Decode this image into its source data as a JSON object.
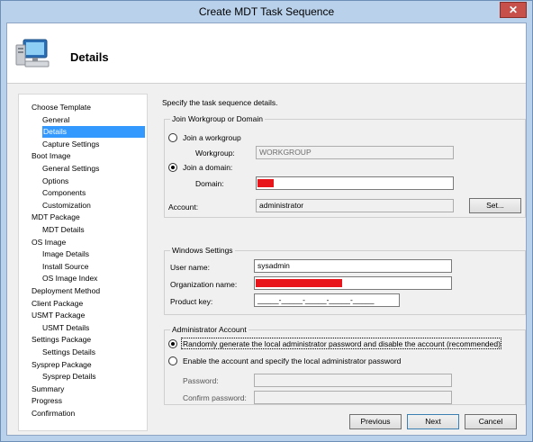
{
  "window": {
    "title": "Create MDT Task Sequence",
    "close_label": "✕"
  },
  "header": {
    "title": "Details",
    "icon": "computer-icon"
  },
  "sidebar": {
    "items": [
      {
        "label": "Choose Template",
        "level": 0,
        "selected": false
      },
      {
        "label": "General",
        "level": 1,
        "selected": false
      },
      {
        "label": "Details",
        "level": 1,
        "selected": true
      },
      {
        "label": "Capture Settings",
        "level": 1,
        "selected": false
      },
      {
        "label": "Boot Image",
        "level": 0,
        "selected": false
      },
      {
        "label": "General Settings",
        "level": 1,
        "selected": false
      },
      {
        "label": "Options",
        "level": 1,
        "selected": false
      },
      {
        "label": "Components",
        "level": 1,
        "selected": false
      },
      {
        "label": "Customization",
        "level": 1,
        "selected": false
      },
      {
        "label": "MDT Package",
        "level": 0,
        "selected": false
      },
      {
        "label": "MDT Details",
        "level": 1,
        "selected": false
      },
      {
        "label": "OS Image",
        "level": 0,
        "selected": false
      },
      {
        "label": "Image Details",
        "level": 1,
        "selected": false
      },
      {
        "label": "Install Source",
        "level": 1,
        "selected": false
      },
      {
        "label": "OS Image Index",
        "level": 1,
        "selected": false
      },
      {
        "label": "Deployment Method",
        "level": 0,
        "selected": false
      },
      {
        "label": "Client Package",
        "level": 0,
        "selected": false
      },
      {
        "label": "USMT Package",
        "level": 0,
        "selected": false
      },
      {
        "label": "USMT Details",
        "level": 1,
        "selected": false
      },
      {
        "label": "Settings Package",
        "level": 0,
        "selected": false
      },
      {
        "label": "Settings Details",
        "level": 1,
        "selected": false
      },
      {
        "label": "Sysprep Package",
        "level": 0,
        "selected": false
      },
      {
        "label": "Sysprep Details",
        "level": 1,
        "selected": false
      },
      {
        "label": "Summary",
        "level": 0,
        "selected": false
      },
      {
        "label": "Progress",
        "level": 0,
        "selected": false
      },
      {
        "label": "Confirmation",
        "level": 0,
        "selected": false
      }
    ]
  },
  "main": {
    "description": "Specify the task sequence details.",
    "join": {
      "group_title": "Join Workgroup or Domain",
      "workgroup_radio": "Join a workgroup",
      "workgroup_label": "Workgroup:",
      "workgroup_value": "WORKGROUP",
      "domain_radio": "Join a domain:",
      "domain_label": "Domain:",
      "account_label": "Account:",
      "account_value": "administrator",
      "set_button": "Set..."
    },
    "windows": {
      "group_title": "Windows Settings",
      "username_label": "User name:",
      "username_value": "sysadmin",
      "org_label": "Organization name:",
      "product_key_label": "Product key:",
      "product_key_value": "_____-_____-_____-_____-_____"
    },
    "admin": {
      "group_title": "Administrator Account",
      "random_radio": "Randomly generate the local administrator password and disable the account (recommended)",
      "enable_radio": "Enable the account and specify the local administrator password",
      "password_label": "Password:",
      "confirm_label": "Confirm password:"
    }
  },
  "footer": {
    "previous": "Previous",
    "next": "Next",
    "cancel": "Cancel"
  },
  "colors": {
    "selection": "#3399ff",
    "redaction": "#e8161b",
    "titlebar": "#b9d1ea"
  }
}
